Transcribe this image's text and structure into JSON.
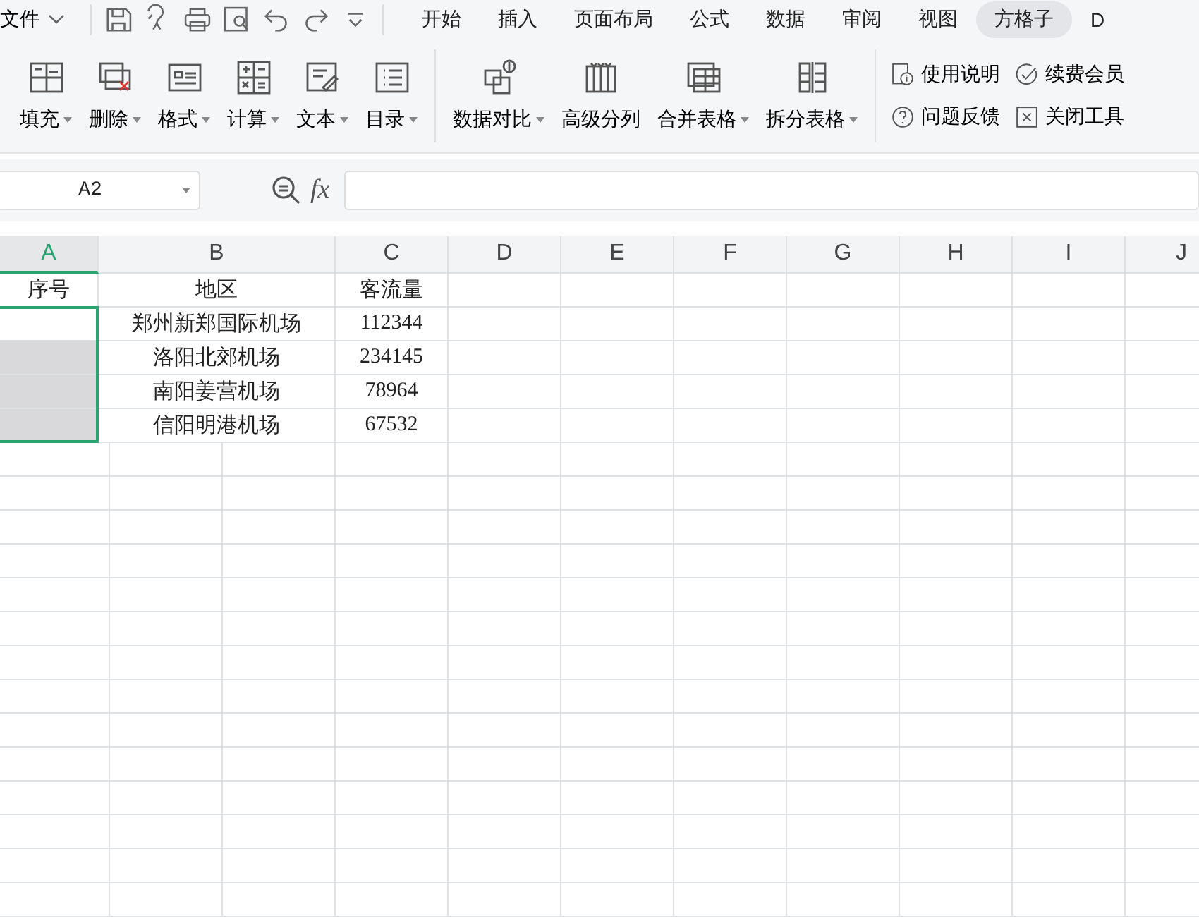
{
  "menu_bar": {
    "file_menu": "文件",
    "tabs": [
      {
        "label": "开始",
        "selected": false
      },
      {
        "label": "插入",
        "selected": false
      },
      {
        "label": "页面布局",
        "selected": false
      },
      {
        "label": "公式",
        "selected": false
      },
      {
        "label": "数据",
        "selected": false
      },
      {
        "label": "审阅",
        "selected": false
      },
      {
        "label": "视图",
        "selected": false
      },
      {
        "label": "方格子",
        "selected": true
      },
      {
        "label": "D",
        "selected": false
      }
    ]
  },
  "ribbon": {
    "groups": [
      {
        "buttons": [
          {
            "label": "填充",
            "dropdown": true
          },
          {
            "label": "删除",
            "dropdown": true
          },
          {
            "label": "格式",
            "dropdown": true
          },
          {
            "label": "计算",
            "dropdown": true
          },
          {
            "label": "文本",
            "dropdown": true
          },
          {
            "label": "目录",
            "dropdown": true
          }
        ]
      },
      {
        "buttons": [
          {
            "label": "数据对比",
            "dropdown": true
          },
          {
            "label": "高级分列",
            "dropdown": false
          },
          {
            "label": "合并表格",
            "dropdown": true
          },
          {
            "label": "拆分表格",
            "dropdown": true
          }
        ]
      }
    ],
    "links": [
      {
        "label": "使用说明"
      },
      {
        "label": "续费会员"
      },
      {
        "label": "问题反馈"
      },
      {
        "label": "关闭工具"
      }
    ]
  },
  "formula_bar": {
    "name_box": "A2",
    "fx": "fx"
  },
  "sheet": {
    "columns": [
      {
        "label": "A",
        "selected": true
      },
      {
        "label": "B",
        "selected": false
      },
      {
        "label": "C",
        "selected": false
      },
      {
        "label": "D",
        "selected": false
      },
      {
        "label": "E",
        "selected": false
      },
      {
        "label": "F",
        "selected": false
      },
      {
        "label": "G",
        "selected": false
      },
      {
        "label": "H",
        "selected": false
      },
      {
        "label": "I",
        "selected": false
      },
      {
        "label": "J",
        "selected": false
      }
    ],
    "rows": [
      [
        {
          "text": "序号",
          "selected": false
        },
        {
          "text": "地区",
          "selected": false
        },
        {
          "text": "客流量",
          "selected": false
        }
      ],
      [
        {
          "selected": true
        },
        {
          "text": "郑州新郑国际机场",
          "selected": false
        },
        {
          "text": "112344",
          "selected": false
        }
      ],
      [
        {
          "selected": true
        },
        {
          "text": "洛阳北郊机场",
          "selected": false
        },
        {
          "text": "234145",
          "selected": false
        }
      ],
      [
        {
          "selected": true
        },
        {
          "text": "南阳姜营机场",
          "selected": false
        },
        {
          "text": "78964",
          "selected": false
        }
      ],
      [
        {
          "selected": true
        },
        {
          "text": "信阳明港机场",
          "selected": false
        },
        {
          "text": "67532",
          "selected": false
        }
      ]
    ]
  }
}
